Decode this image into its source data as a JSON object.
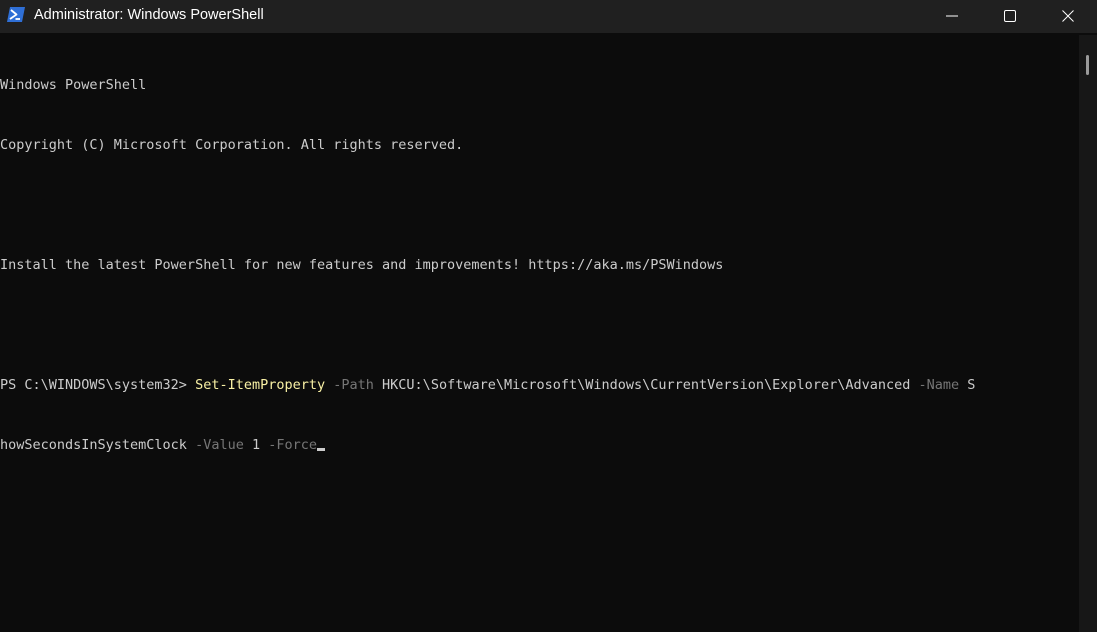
{
  "window": {
    "title": "Administrator: Windows PowerShell",
    "icon": "powershell-icon",
    "controls": [
      "minimize-icon",
      "maximize-icon",
      "close-icon"
    ]
  },
  "console": {
    "banner_line1": "Windows PowerShell",
    "banner_line2": "Copyright (C) Microsoft Corporation. All rights reserved.",
    "install_notice": "Install the latest PowerShell for new features and improvements! https://aka.ms/PSWindows",
    "prompt": "PS C:\\WINDOWS\\system32> ",
    "command": {
      "cmdlet": "Set-ItemProperty",
      "param_path": "-Path",
      "value_path": "HKCU:\\Software\\Microsoft\\Windows\\CurrentVersion\\Explorer\\Advanced",
      "param_name": "-Name",
      "value_name_part1": "S",
      "value_name_part2": "howSecondsInSystemClock",
      "param_value": "-Value",
      "value_value": "1",
      "param_force": "-Force"
    }
  },
  "colors": {
    "background": "#0c0c0c",
    "titlebar": "#202020",
    "text": "#cccccc",
    "cmdlet": "#f9f1a5",
    "parameter": "#767676"
  }
}
